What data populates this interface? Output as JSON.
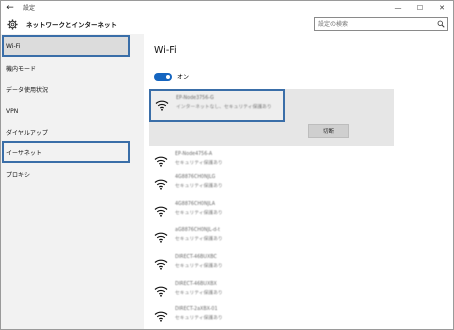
{
  "window": {
    "title": "設定"
  },
  "header": {
    "title": "ネットワークとインターネット"
  },
  "search": {
    "placeholder": "設定の検索"
  },
  "sidebar": {
    "items": [
      {
        "label": "Wi-Fi"
      },
      {
        "label": "機内モード"
      },
      {
        "label": "データ使用状況"
      },
      {
        "label": "VPN"
      },
      {
        "label": "ダイヤルアップ"
      },
      {
        "label": "イーサネット"
      },
      {
        "label": "プロキシ"
      }
    ]
  },
  "main": {
    "title": "Wi-Fi",
    "toggle_label": "オン",
    "selected_network": {
      "name": "EP-Node3756-G",
      "status": "インターネットなし、セキュリティ保護あり",
      "connect_label": "切断"
    },
    "networks": [
      {
        "name": "EP-Node4756-A",
        "status": "セキュリティ保護あり"
      },
      {
        "name": "4G8876CH0NJLG",
        "status": "セキュリティ保護あり"
      },
      {
        "name": "4G8876CH0NJLA",
        "status": "セキュリティ保護あり"
      },
      {
        "name": "aG8876CH0NJL-d-t",
        "status": "セキュリティ保護あり"
      },
      {
        "name": "DIRECT-46BUXBC",
        "status": "セキュリティ保護あり"
      },
      {
        "name": "DIRECT-46BUXBX",
        "status": "セキュリティ保護あり"
      },
      {
        "name": "DIRECT-2aXBX-01",
        "status": "セキュリティ保護あり"
      }
    ]
  },
  "colors": {
    "accent": "#1565c0",
    "focus_border": "#3a6ea8",
    "sidebar_bg": "#f2f2f2"
  },
  "icons": {
    "back": "back-arrow-icon",
    "gear": "gear-icon",
    "search": "search-icon",
    "minimize": "minimize-icon",
    "maximize": "maximize-icon",
    "close": "close-icon",
    "wifi": "wifi-signal-icon"
  }
}
